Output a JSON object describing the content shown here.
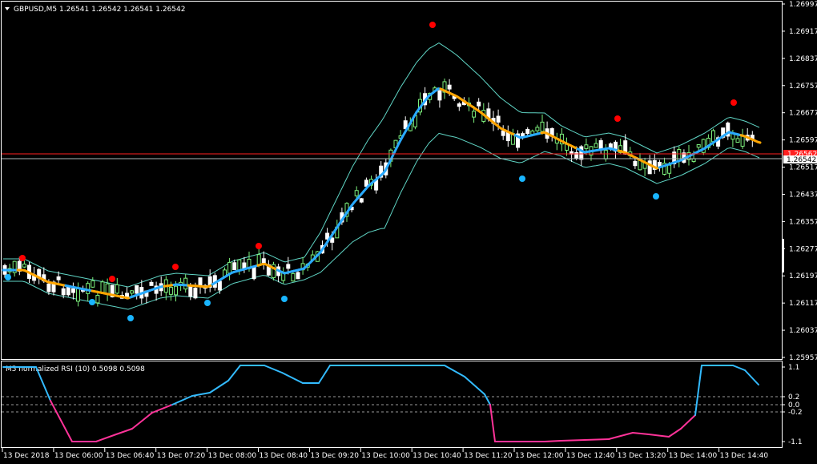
{
  "header": {
    "symbol_text": "GBPUSD,M5  1.26541 1.26542 1.26541 1.26542",
    "dropdown_icon": "triangle-down-icon"
  },
  "main_chart": {
    "price_labels": [
      "1.26997",
      "1.26917",
      "1.26837",
      "1.26757",
      "1.26677",
      "1.26597",
      "1.26517",
      "1.26437",
      "1.26357",
      "1.26277",
      "1.26197",
      "1.26117",
      "1.26037",
      "1.25957"
    ],
    "current_bid_label": "1.26542",
    "ask_box_label": "1.26562",
    "y_range": [
      1.25957,
      1.26997
    ]
  },
  "indicator": {
    "title": "M5 normalized RSI (10) 0.5098 0.5098",
    "levels": [
      "1.1",
      "0.2",
      "0.0",
      "-0.2",
      "-1.1"
    ]
  },
  "time_axis": {
    "labels": [
      "13 Dec 2018",
      "13 Dec 06:00",
      "13 Dec 06:40",
      "13 Dec 07:20",
      "13 Dec 08:00",
      "13 Dec 08:40",
      "13 Dec 09:20",
      "13 Dec 10:00",
      "13 Dec 10:40",
      "13 Dec 11:20",
      "13 Dec 12:00",
      "13 Dec 12:40",
      "13 Dec 13:20",
      "13 Dec 14:00",
      "13 Dec 14:40"
    ]
  },
  "colors": {
    "candle_up": "#7cf07c",
    "candle_down": "#ffffff",
    "ma_up": "#29aaff",
    "ma_down": "#ffa500",
    "band": "#5fd4c4",
    "dot_red": "#ff0000",
    "dot_blue": "#19b5ff",
    "rsi_up": "#33bbff",
    "rsi_down": "#ff3399",
    "bid_line": "#aeb6b8",
    "ask_line": "#ff2020"
  }
}
